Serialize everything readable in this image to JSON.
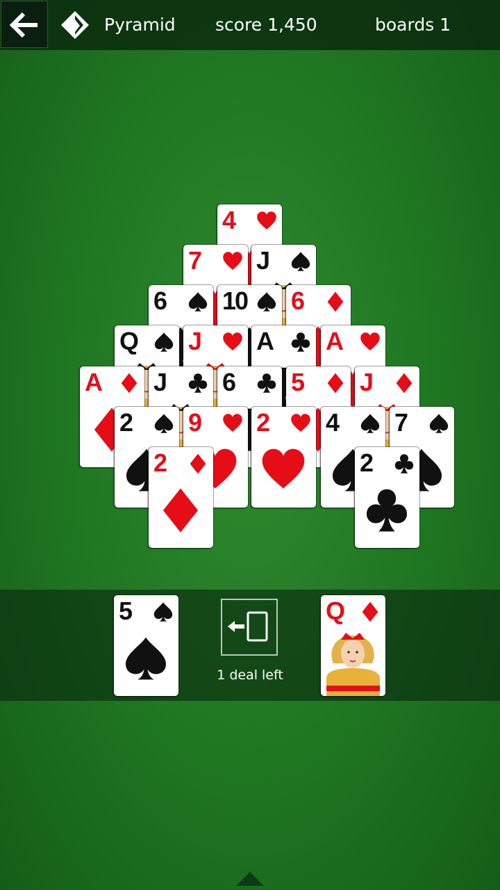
{
  "header": {
    "game_name": "Pyramid",
    "score": "score 1,450",
    "boards": "boards 1"
  },
  "suit_colors": {
    "red": "#e60d17",
    "black": "#111111"
  },
  "icons": {
    "back": "arrow-left-icon",
    "game": "pyramid-icon",
    "deal": "deal-from-stock-icon",
    "expand": "chevron-up-icon"
  },
  "pyramid_rows": [
    [
      {
        "rank": "4",
        "suit": "hearts"
      }
    ],
    [
      {
        "rank": "7",
        "suit": "hearts"
      },
      {
        "rank": "J",
        "suit": "spades"
      }
    ],
    [
      {
        "rank": "6",
        "suit": "spades"
      },
      {
        "rank": "10",
        "suit": "spades"
      },
      {
        "rank": "6",
        "suit": "diamonds"
      }
    ],
    [
      {
        "rank": "Q",
        "suit": "spades"
      },
      {
        "rank": "J",
        "suit": "hearts"
      },
      {
        "rank": "A",
        "suit": "clubs"
      },
      {
        "rank": "A",
        "suit": "hearts"
      }
    ],
    [
      {
        "rank": "A",
        "suit": "diamonds"
      },
      {
        "rank": "J",
        "suit": "clubs"
      },
      {
        "rank": "6",
        "suit": "clubs"
      },
      {
        "rank": "5",
        "suit": "diamonds"
      },
      {
        "rank": "J",
        "suit": "diamonds"
      }
    ],
    [
      {
        "rank": "2",
        "suit": "spades"
      },
      {
        "rank": "9",
        "suit": "hearts"
      },
      {
        "rank": "2",
        "suit": "hearts"
      },
      {
        "rank": "4",
        "suit": "spades"
      },
      {
        "rank": "7",
        "suit": "spades"
      }
    ],
    [
      {
        "rank": "2",
        "suit": "diamonds"
      },
      {
        "rank": "2",
        "suit": "clubs"
      }
    ]
  ],
  "tray": {
    "stock_card": {
      "rank": "5",
      "suit": "spades"
    },
    "deal_label": "1 deal left",
    "waste_card": {
      "rank": "Q",
      "suit": "diamonds"
    }
  }
}
